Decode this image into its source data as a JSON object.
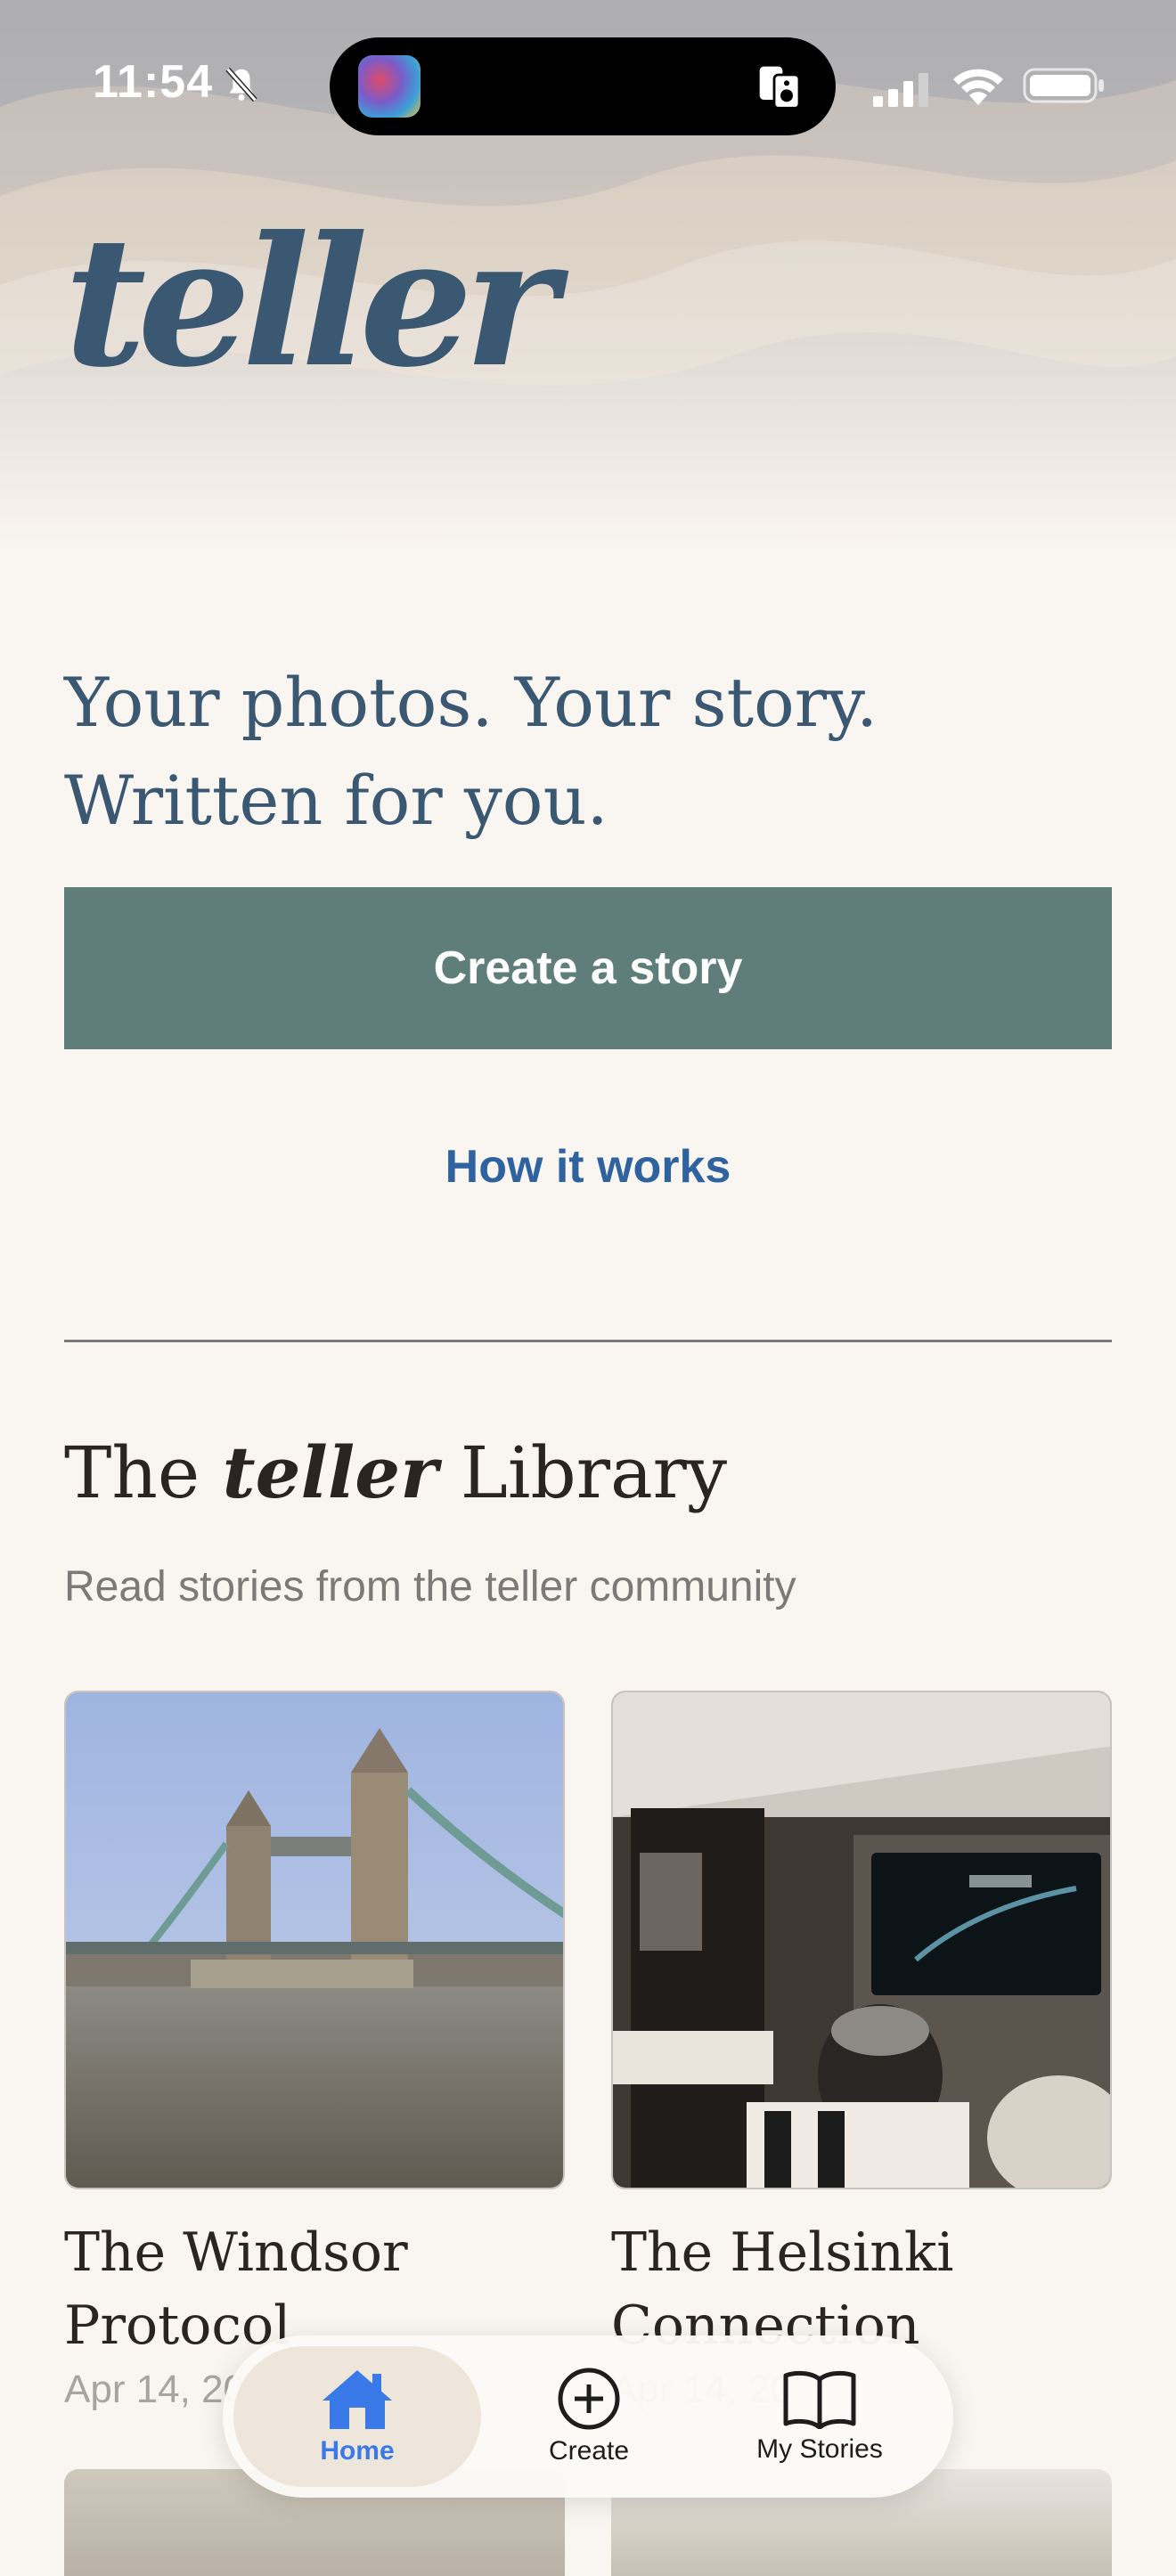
{
  "status_bar": {
    "time": "11:54"
  },
  "brand": {
    "logo": "teller"
  },
  "hero": {
    "tagline": "Your photos. Your story. Written for you.",
    "cta_label": "Create a story",
    "how_label": "How it works"
  },
  "library": {
    "title_prefix": "The",
    "title_brand": "teller",
    "title_suffix": "Library",
    "subtitle": "Read stories from the teller community",
    "stories": [
      {
        "title": "The Windsor Protocol",
        "date": "Apr 14, 20"
      },
      {
        "title": "The Helsinki Connection",
        "date": "Apr 14, 20"
      }
    ]
  },
  "tabbar": {
    "tabs": [
      {
        "label": "Home",
        "icon": "house-icon"
      },
      {
        "label": "Create",
        "icon": "plus-circle-icon"
      },
      {
        "label": "My Stories",
        "icon": "book-icon"
      }
    ],
    "active_color": "#3a7ae8"
  },
  "colors": {
    "brand_blue": "#3b5872",
    "cta_green": "#5f7e79",
    "link_blue": "#2f63a0",
    "background": "#f9f5f1"
  }
}
